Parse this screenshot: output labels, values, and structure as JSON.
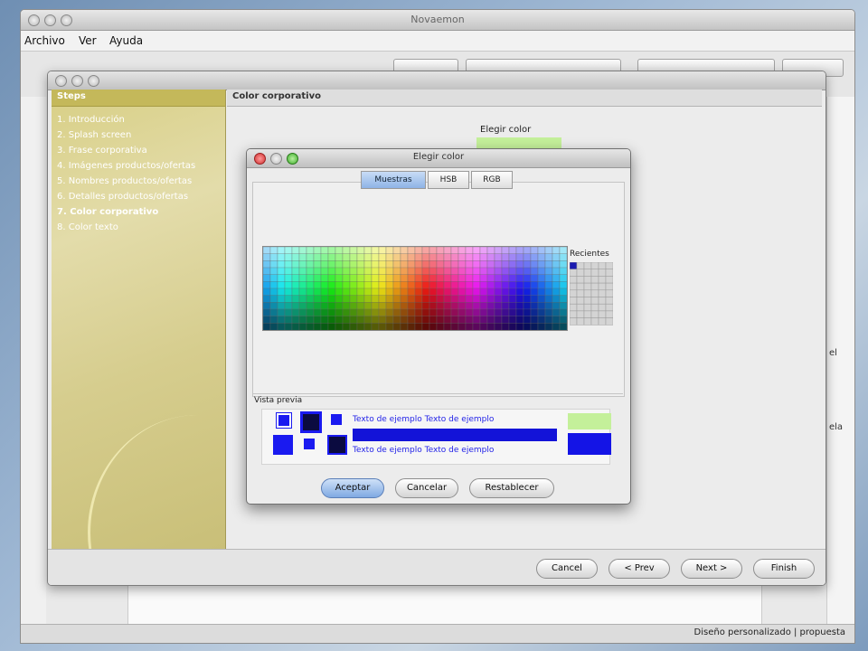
{
  "main_window": {
    "title": "Novaemon",
    "menu": [
      "Archivo",
      "Ver",
      "Ayuda"
    ],
    "status_text": "Diseño personalizado | propuesta",
    "right_fragments": [
      "el",
      "ela"
    ]
  },
  "wizard": {
    "steps_title": "Steps",
    "steps": [
      "1. Introducción",
      "2. Splash screen",
      "3. Frase corporativa",
      "4. Imágenes productos/ofertas",
      "5. Nombres productos/ofertas",
      "6. Detalles productos/ofertas",
      "7. Color corporativo",
      "8. Color texto"
    ],
    "current_step_index": 6,
    "content_title": "Color corporativo",
    "choose_color_label": "Elegir color",
    "selected_color": "#c4f09a",
    "buttons": {
      "cancel": "Cancel",
      "prev": "< Prev",
      "next": "Next >",
      "finish": "Finish"
    }
  },
  "color_dialog": {
    "title": "Elegir color",
    "tabs": [
      "Muestras",
      "HSB",
      "RGB"
    ],
    "active_tab": "Muestras",
    "recent_label": "Recientes",
    "recent_colors": [
      "#1a1ab0"
    ],
    "preview_label": "Vista previa",
    "sample_text": "Texto de ejemplo  Texto de ejemplo",
    "preview_fg_color": "#1414e6",
    "preview_bg_color": "#c4f09a",
    "buttons": {
      "accept": "Aceptar",
      "cancel": "Cancelar",
      "reset": "Restablecer"
    }
  }
}
